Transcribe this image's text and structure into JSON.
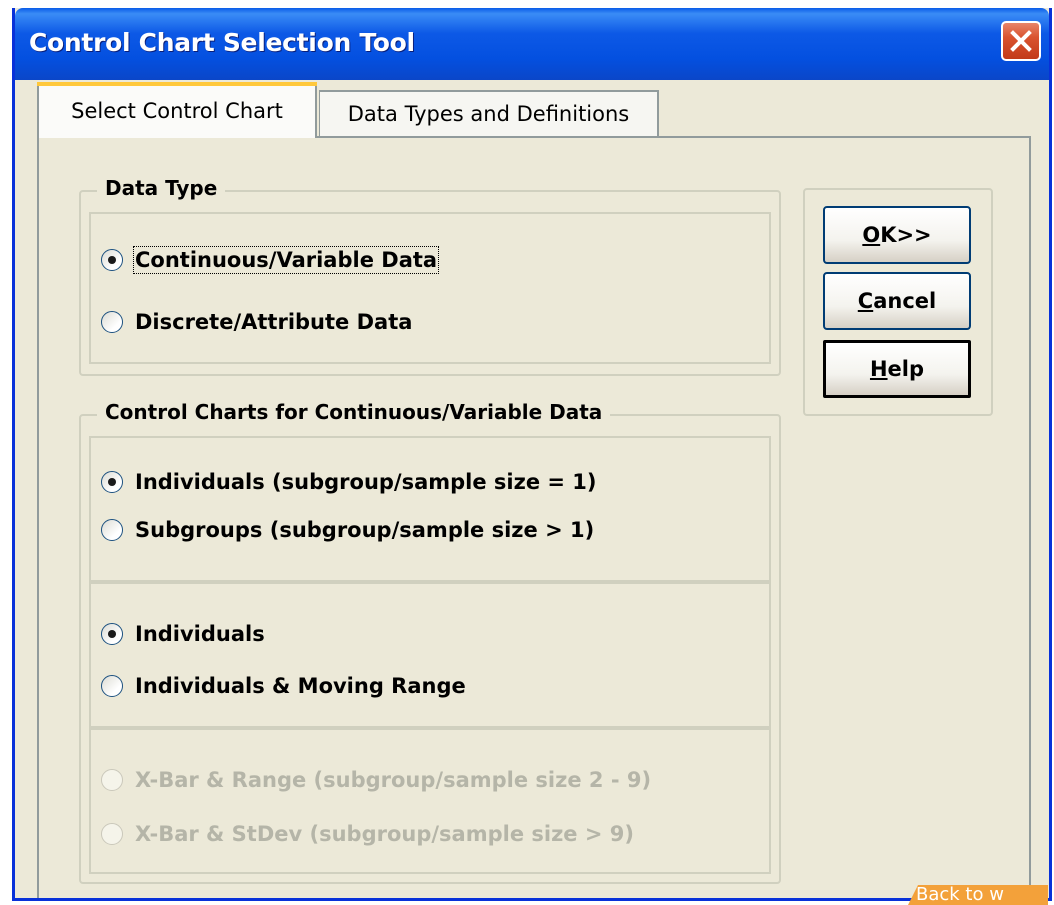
{
  "window": {
    "title": "Control Chart Selection Tool"
  },
  "tabs": [
    {
      "label": "Select Control Chart",
      "active": true
    },
    {
      "label": "Data Types and Definitions",
      "active": false
    }
  ],
  "data_type_group": {
    "legend": "Data Type",
    "options": [
      {
        "label": "Continuous/Variable Data",
        "checked": true
      },
      {
        "label": "Discrete/Attribute Data",
        "checked": false
      }
    ]
  },
  "charts_group": {
    "legend": "Control Charts for Continuous/Variable Data",
    "sample_size_options": [
      {
        "label": "Individuals (subgroup/sample size = 1)",
        "checked": true
      },
      {
        "label": "Subgroups (subgroup/sample size > 1)",
        "checked": false
      }
    ],
    "individuals_options": [
      {
        "label": "Individuals",
        "checked": true
      },
      {
        "label": "Individuals & Moving Range",
        "checked": false
      }
    ],
    "subgroup_options": [
      {
        "label": "X-Bar & Range (subgroup/sample size 2 - 9)",
        "checked": false,
        "disabled": true
      },
      {
        "label": "X-Bar & StDev (subgroup/sample size > 9)",
        "checked": false,
        "disabled": true
      }
    ]
  },
  "buttons": {
    "ok": {
      "mnemonic": "O",
      "rest": "K>>"
    },
    "cancel": {
      "mnemonic": "C",
      "rest": "ancel"
    },
    "help": {
      "mnemonic": "H",
      "rest": "elp"
    }
  },
  "corner_badge": "Back to w"
}
